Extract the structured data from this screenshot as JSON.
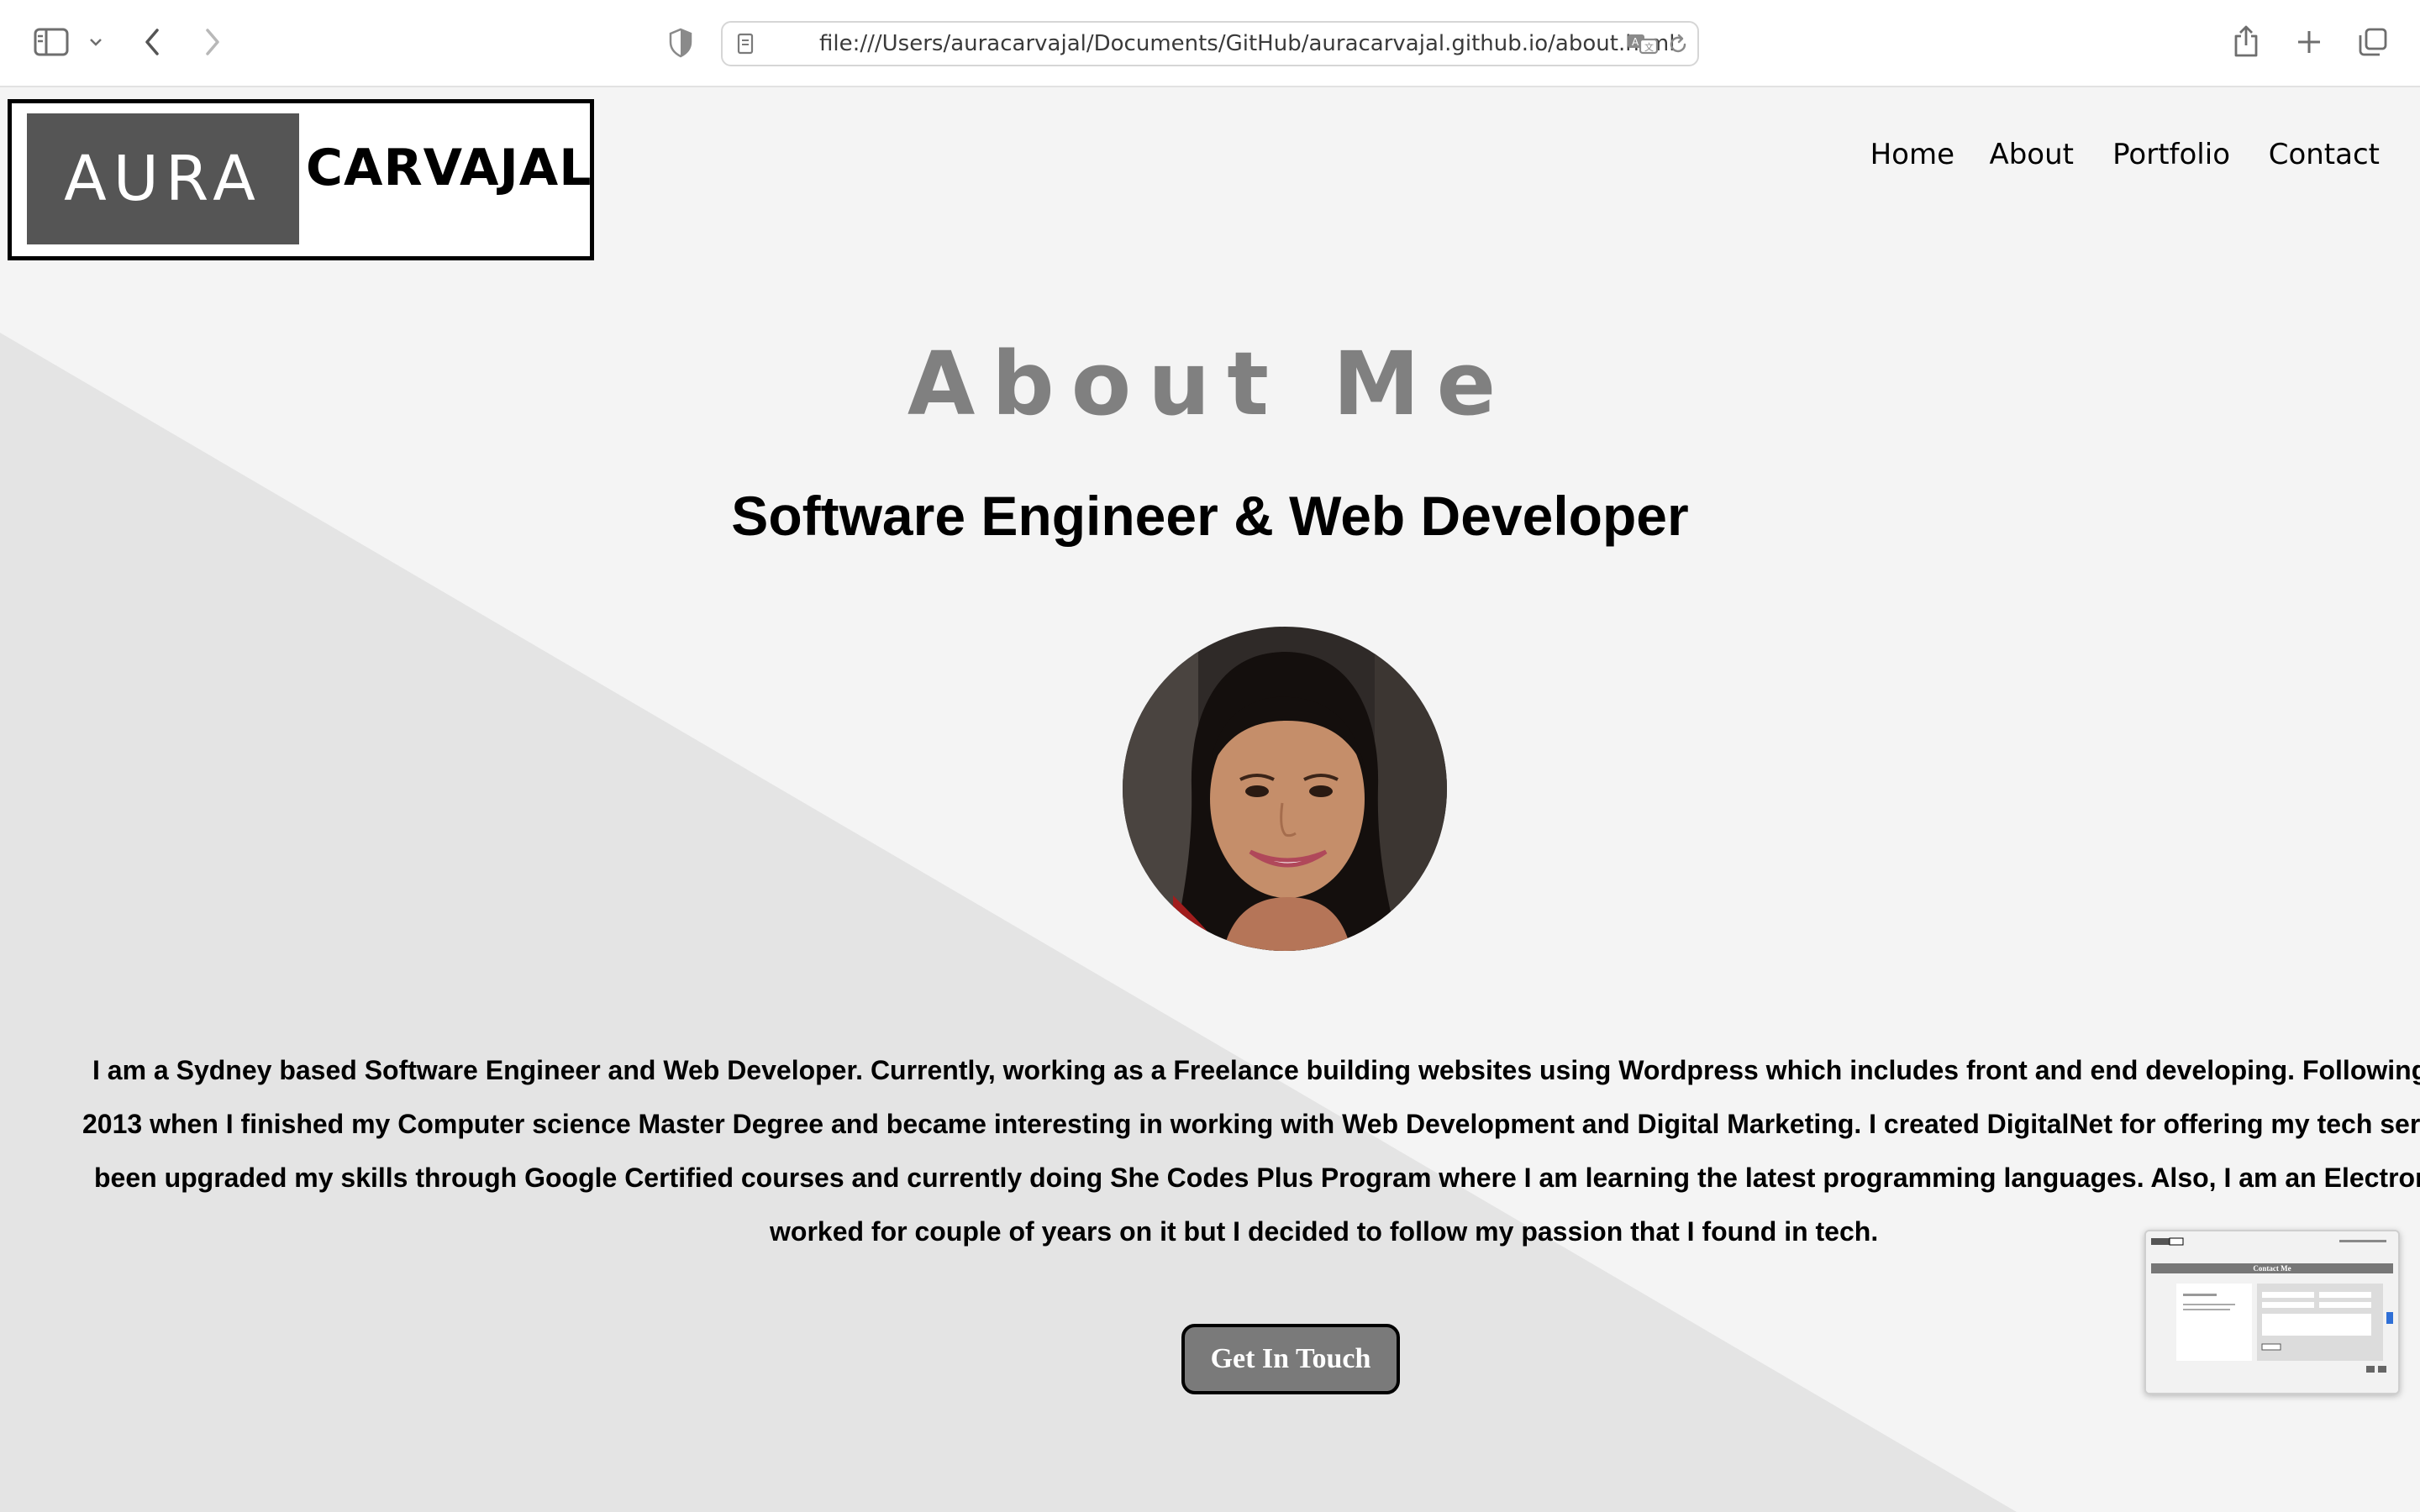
{
  "browser": {
    "url": "file:///Users/auracarvajal/Documents/GitHub/auracarvajal.github.io/about.html",
    "icons": [
      "sidebar-icon",
      "chevron-down-icon",
      "back-icon",
      "forward-icon",
      "shield-icon",
      "page-icon",
      "translate-icon",
      "reload-icon",
      "share-icon",
      "new-tab-icon",
      "tabs-overview-icon"
    ]
  },
  "logo": {
    "left_text": "AURA",
    "right_text": "CARVAJAL"
  },
  "nav": {
    "items": [
      "Home",
      "About",
      "Portfolio",
      "Contact"
    ]
  },
  "main": {
    "heading": "About Me",
    "subheading": "Software Engineer & Web Developer",
    "bio_lines": [
      "I am a Sydney based Software Engineer and Web Developer. Currently, working as a Freelance building websites using Wordpress which includes front and end developing. Following my passion",
      "2013 when I finished my Computer science Master Degree and became interesting in working with Web Development and Digital Marketing. I created DigitalNet for offering my tech services and",
      "been upgraded my skills through Google Certified courses and currently doing She Codes Plus Program where I am learning the latest programming languages. Also, I am an Electronic Engineer",
      "worked for couple of years on it but I decided to follow my passion that I found in tech."
    ],
    "cta_label": "Get In Touch"
  },
  "thumbnail": {
    "title": "Contact Me"
  },
  "colors": {
    "page_bg": "#f4f4f4",
    "diagonal_bg": "#e4e4e4",
    "heading": "#808080",
    "button_bg": "#7a7a7a",
    "logo_dark": "#555555"
  }
}
